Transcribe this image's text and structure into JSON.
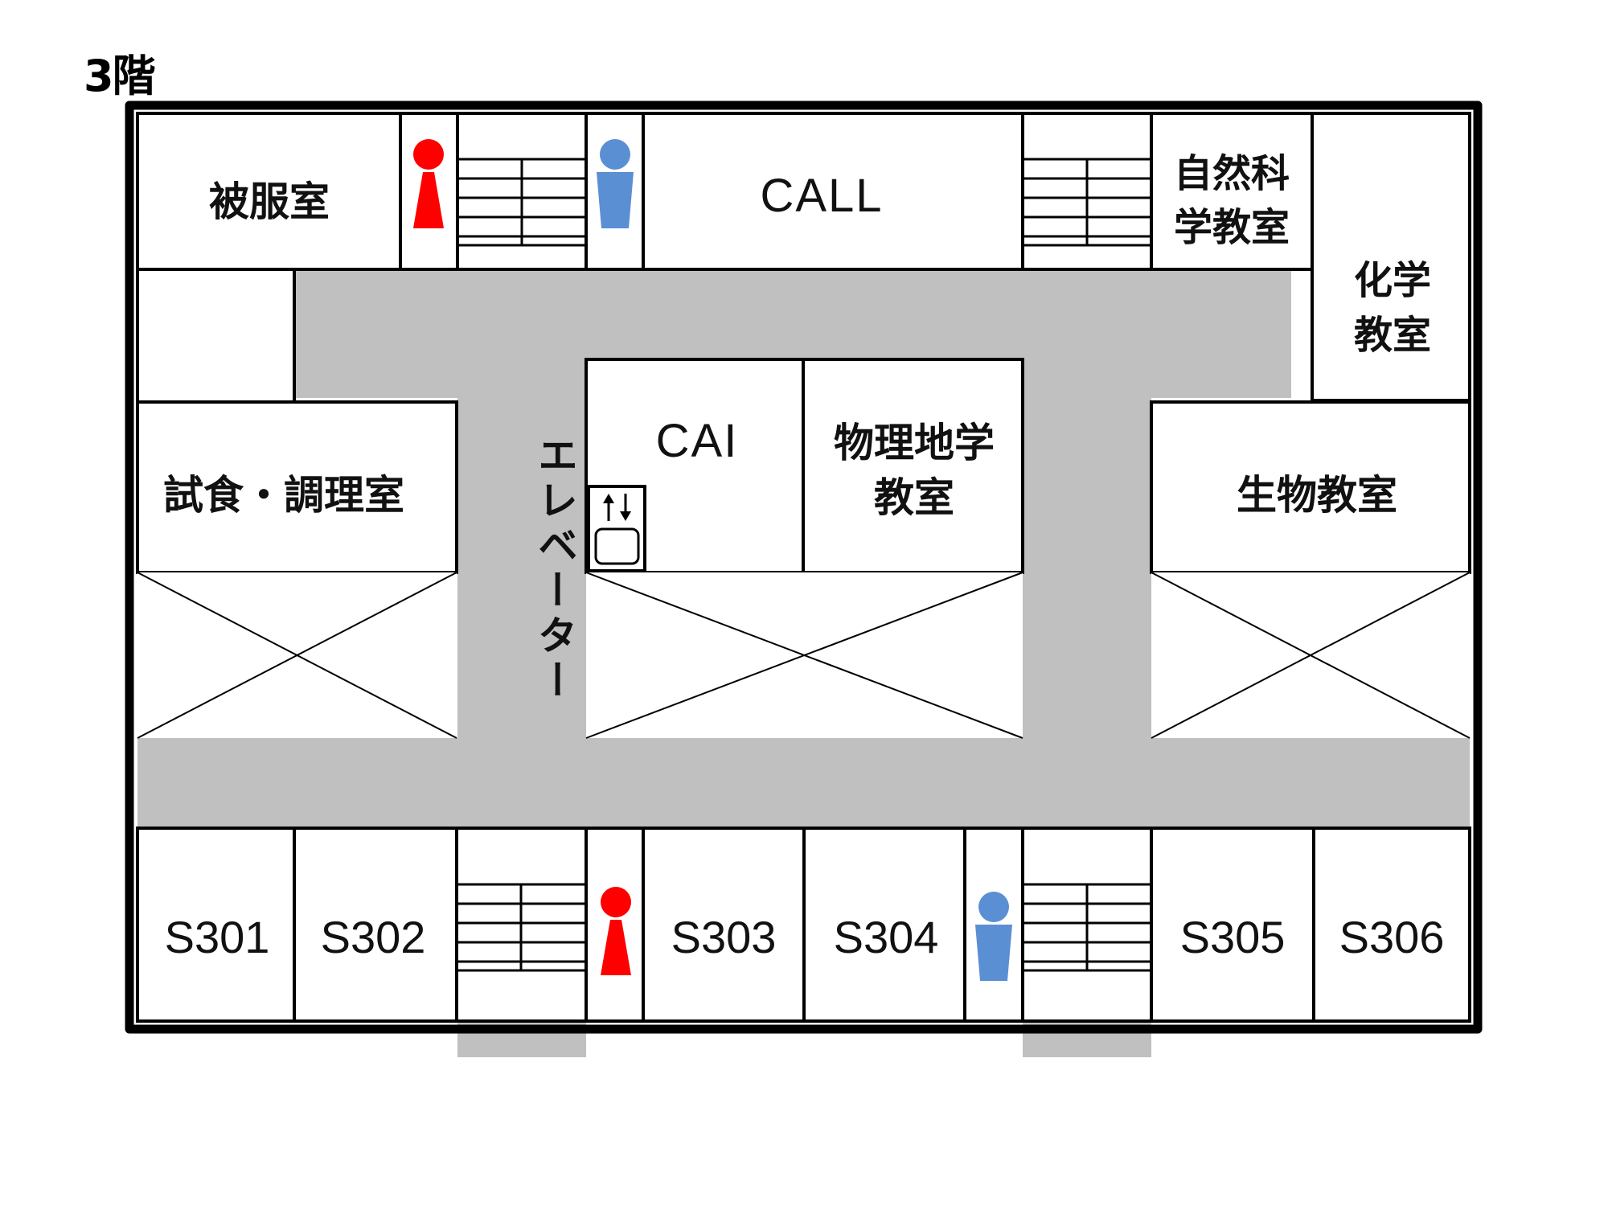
{
  "floor": {
    "label": "3階"
  },
  "rooms": {
    "hifuku": "被服室",
    "call": "CALL",
    "shizen_1": "自然科",
    "shizen_2": "学教室",
    "kagaku_1": "化学",
    "kagaku_2": "教室",
    "shishoku": "試食・調理室",
    "cai": "CAI",
    "butsuri_1": "物理地学",
    "butsuri_2": "教室",
    "seibutsu": "生物教室",
    "s301": "S301",
    "s302": "S302",
    "s303": "S303",
    "s304": "S304",
    "s305": "S305",
    "s306": "S306"
  },
  "elevator": {
    "label": "エレベーター"
  },
  "icons": {
    "female": "female-restroom-icon",
    "male": "male-restroom-icon",
    "elevator": "elevator-icon",
    "stairs": "stairs-icon"
  },
  "colors": {
    "corridor": "#c0c0c0",
    "female": "#ff0000",
    "male": "#5b8fd4",
    "wall": "#000000"
  }
}
